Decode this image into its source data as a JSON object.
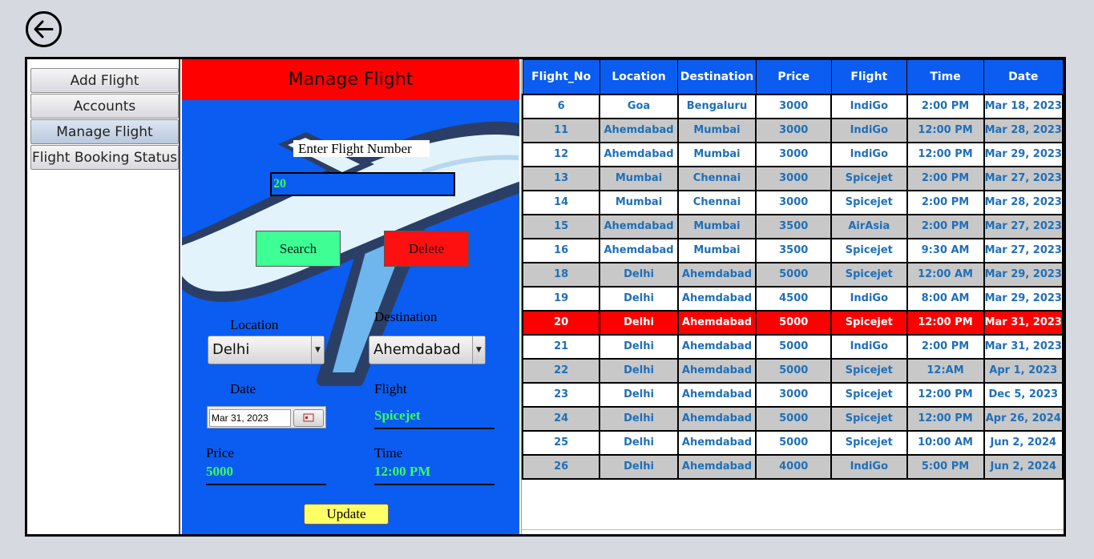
{
  "back_button": {
    "icon": "arrow-left-icon"
  },
  "sidebar": {
    "items": [
      {
        "label": "Add Flight",
        "active": false
      },
      {
        "label": "Accounts",
        "active": false
      },
      {
        "label": "Manage Flight",
        "active": true
      },
      {
        "label": "Flight Booking Status",
        "active": false
      }
    ]
  },
  "form": {
    "title": "Manage Flight",
    "enter_label": "Enter Flight Number",
    "flight_number_value": "20",
    "search_label": "Search",
    "delete_label": "Delete",
    "location_label": "Location",
    "location_value": "Delhi",
    "destination_label": "Destination",
    "destination_value": "Ahemdabad",
    "date_label": "Date",
    "date_value": "Mar 31, 2023",
    "flight_label": "Flight",
    "flight_value": "Spicejet",
    "price_label": "Price",
    "price_value": "5000",
    "time_label": "Time",
    "time_value": "12:00 PM",
    "update_label": "Update",
    "colors": {
      "header": "#ff0000",
      "panel": "#0b5cf0",
      "value_text": "#39ff5c",
      "search": "#3dff94",
      "delete": "#ff1010",
      "update": "#ffff66"
    }
  },
  "table": {
    "columns": [
      "Flight_No",
      "Location",
      "Destination",
      "Price",
      "Flight",
      "Time",
      "Date"
    ],
    "selected_row": 9,
    "rows": [
      [
        "6",
        "Goa",
        "Bengaluru",
        "3000",
        "IndiGo",
        "2:00 PM",
        "Mar 18, 2023"
      ],
      [
        "11",
        "Ahemdabad",
        "Mumbai",
        "3000",
        "IndiGo",
        "12:00 PM",
        "Mar 28, 2023"
      ],
      [
        "12",
        "Ahemdabad",
        "Mumbai",
        "3000",
        "IndiGo",
        "12:00 PM",
        "Mar 29, 2023"
      ],
      [
        "13",
        "Mumbai",
        "Chennai",
        "3000",
        "Spicejet",
        "2:00 PM",
        "Mar 27, 2023"
      ],
      [
        "14",
        "Mumbai",
        "Chennai",
        "3000",
        "Spicejet",
        "2:00 PM",
        "Mar 28, 2023"
      ],
      [
        "15",
        "Ahemdabad",
        "Mumbai",
        "3500",
        "AirAsia",
        "2:00 PM",
        "Mar 27, 2023"
      ],
      [
        "16",
        "Ahemdabad",
        "Mumbai",
        "3500",
        "Spicejet",
        "9:30 AM",
        "Mar 27, 2023"
      ],
      [
        "18",
        "Delhi",
        "Ahemdabad",
        "5000",
        "Spicejet",
        "12:00 AM",
        "Mar 29, 2023"
      ],
      [
        "19",
        "Delhi",
        "Ahemdabad",
        "4500",
        "IndiGo",
        "8:00 AM",
        "Mar 29, 2023"
      ],
      [
        "20",
        "Delhi",
        "Ahemdabad",
        "5000",
        "Spicejet",
        "12:00 PM",
        "Mar 31, 2023"
      ],
      [
        "21",
        "Delhi",
        "Ahemdabad",
        "5000",
        "IndiGo",
        "2:00 PM",
        "Mar 31, 2023"
      ],
      [
        "22",
        "Delhi",
        "Ahemdabad",
        "5000",
        "Spicejet",
        "12:AM",
        "Apr 1, 2023"
      ],
      [
        "23",
        "Delhi",
        "Ahemdabad",
        "3000",
        "Spicejet",
        "12:00 PM",
        "Dec 5, 2023"
      ],
      [
        "24",
        "Delhi",
        "Ahemdabad",
        "5000",
        "Spicejet",
        "12:00 PM",
        "Apr 26, 2024"
      ],
      [
        "25",
        "Delhi",
        "Ahemdabad",
        "5000",
        "Spicejet",
        "10:00 AM",
        "Jun 2, 2024"
      ],
      [
        "26",
        "Delhi",
        "Ahemdabad",
        "4000",
        "IndiGo",
        "5:00 PM",
        "Jun 2, 2024"
      ]
    ],
    "colors": {
      "header": "#0b5cf0",
      "selected": "#ff0000",
      "text": "#1f6fb8",
      "alt_row": "#c8c8c8"
    }
  }
}
